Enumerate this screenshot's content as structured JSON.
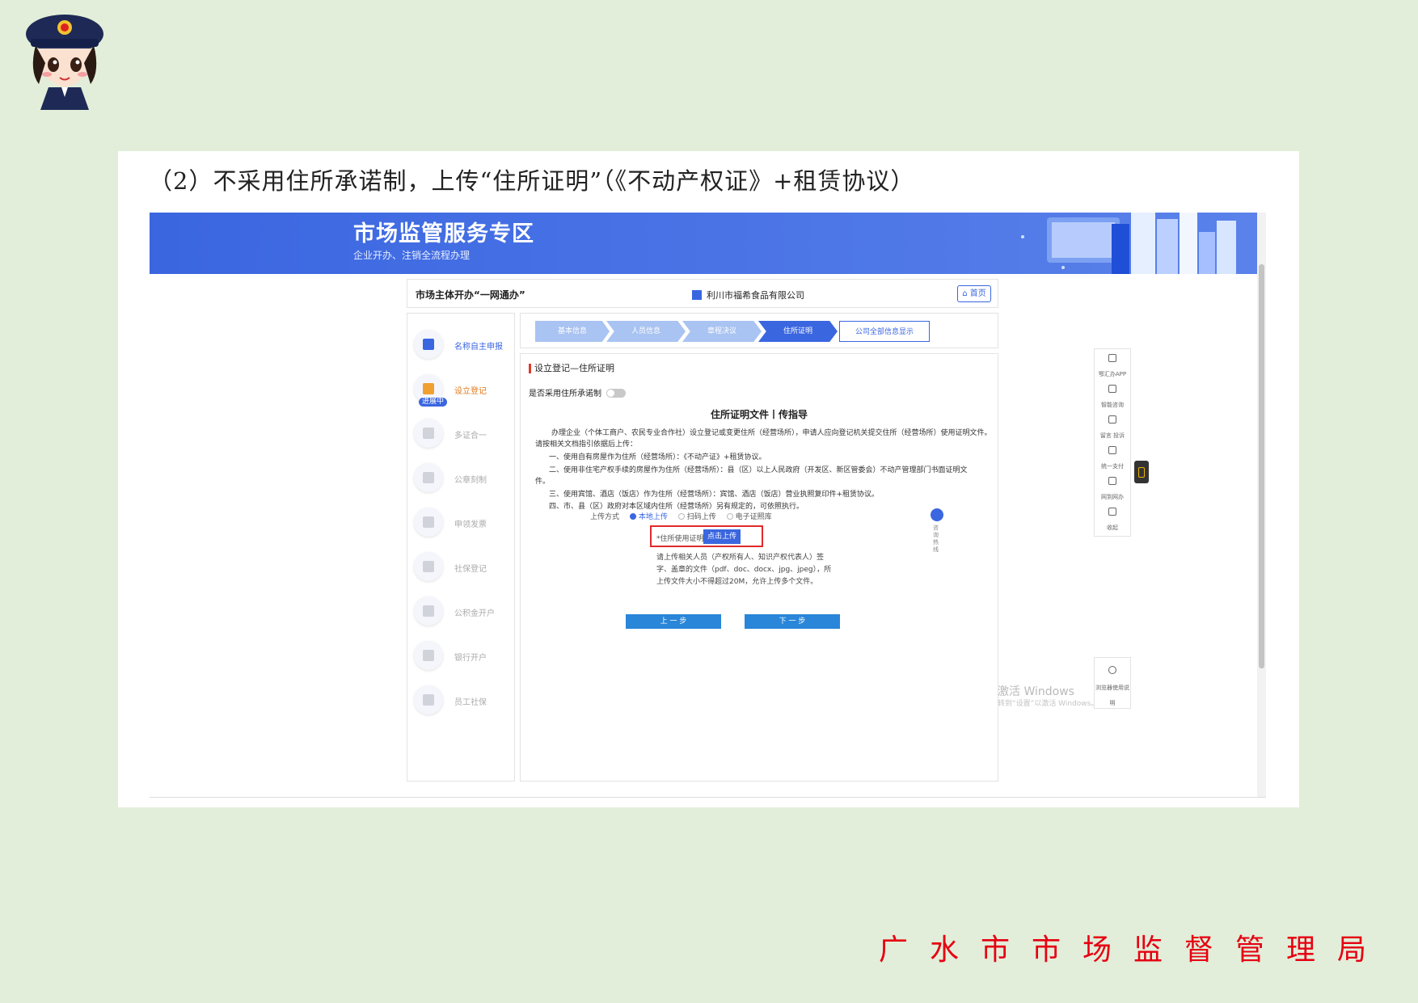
{
  "caption": "（2）不采用住所承诺制，上传“住所证明”（《不动产权证》+租赁协议）",
  "banner": {
    "title": "市场监管服务专区",
    "subtitle": "企业开办、注销全流程办理"
  },
  "header": {
    "title": "市场主体开办“一网通办”",
    "company": "利川市福希食品有限公司",
    "home_label": "首页"
  },
  "sidebar": {
    "items": [
      {
        "label": "名称自主申报",
        "icon": "edit-icon"
      },
      {
        "label": "设立登记",
        "icon": "form-icon"
      },
      {
        "label": "多证合一",
        "icon": "id-card-icon"
      },
      {
        "label": "公章刻制",
        "icon": "stamp-icon"
      },
      {
        "label": "申领发票",
        "icon": "invoice-icon"
      },
      {
        "label": "社保登记",
        "icon": "shield-icon"
      },
      {
        "label": "公积金开户",
        "icon": "house-icon"
      },
      {
        "label": "银行开户",
        "icon": "bank-icon"
      },
      {
        "label": "员工社保",
        "icon": "document-icon"
      }
    ],
    "badge": "进展中"
  },
  "steps": [
    "基本信息",
    "人员信息",
    "章程决议",
    "住所证明",
    "公司全部信息显示"
  ],
  "content": {
    "section_title": "设立登记—住所证明",
    "option_label": "是否采用住所承诺制",
    "guide_title": "住所证明文件丨传指导",
    "paragraphs": [
      "办理企业（个体工商户、农民专业合作社）设立登记或变更住所（经营场所），申请人应向登记机关提交住所（经营场所）使用证明文件。",
      "请按相关文档指引依据后上传：",
      "一、使用自有房屋作为住所（经营场所）：《不动产证》+租赁协议。",
      "二、使用非住宅产权手续的房屋作为住所（经营场所）：县（区）以上人民政府（开发区、新区管委会）不动产管理部门书面证明文",
      "件。",
      "三、使用宾馆、酒店（饭店）作为住所（经营场所）：宾馆、酒店（饭店）营业执照复印件+租赁协议。",
      "四、市、县（区）政府对本区域内住所（经营场所）另有规定的，可依照执行。"
    ],
    "upload_mode_label": "上传方式",
    "upload_modes": [
      "本地上传",
      "扫码上传",
      "电子证照库"
    ],
    "upload_field_label": "*住所使用证明",
    "upload_button": "点击上传",
    "notes": [
      "请上传相关人员（产权所有人、知识产权代表人）签",
      "字、盖章的文件（pdf、doc、docx、jpg、jpeg），所",
      "上传文件大小不得超过20M，允许上传多个文件。"
    ],
    "prev_button": "上 一 步",
    "next_button": "下 一 步"
  },
  "hotline_label": "咨询热线",
  "right_tools": [
    {
      "label": "鄂汇办APP",
      "icon": "phone-icon"
    },
    {
      "label": "智能咨询",
      "icon": "headset-icon"
    },
    {
      "label": "留言 投诉",
      "icon": "message-icon"
    },
    {
      "label": "统一支付",
      "icon": "yuan-icon"
    },
    {
      "label": "网到网办",
      "icon": "share-icon"
    },
    {
      "label": "收起",
      "icon": "collapse-icon"
    }
  ],
  "browser_tool": "浏览器使用说明",
  "watermark": {
    "line1": "激活 Windows",
    "line2": "转到“设置”以激活 Windows。"
  },
  "footer": "广水市市场监督管理局",
  "colors": {
    "banner": "#3a66e0",
    "page_bg": "#e2eed9",
    "footer_red": "#e60012",
    "highlight_red": "#e02a2a"
  }
}
